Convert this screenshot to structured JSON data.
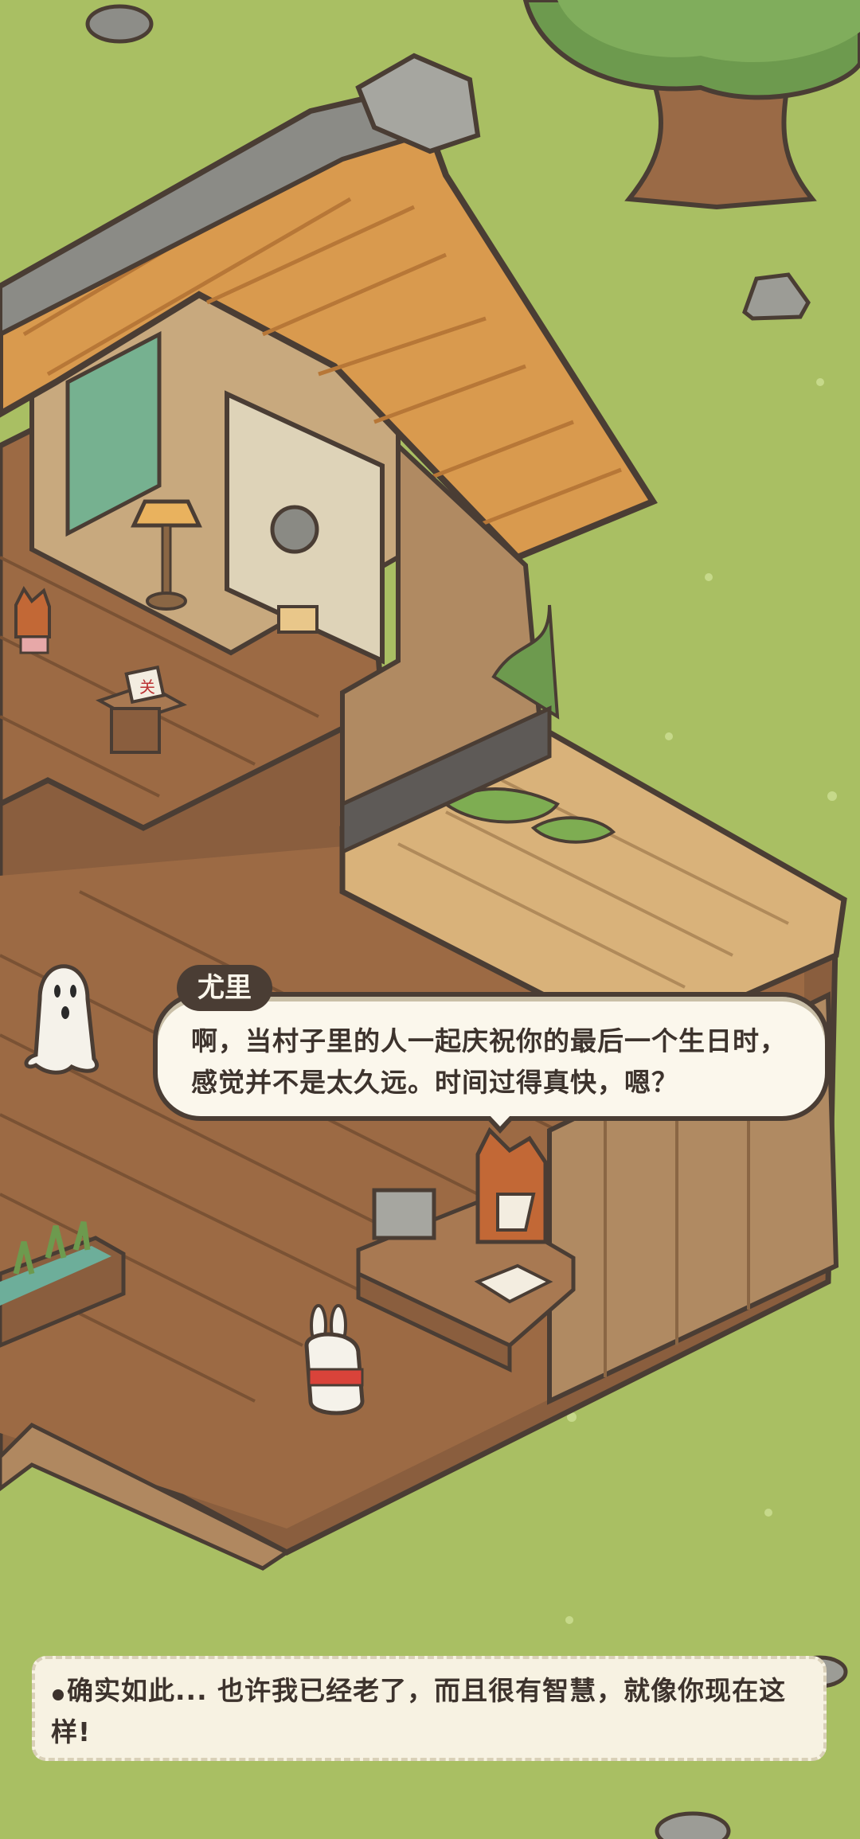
{
  "dialogue": {
    "speaker": "尤里",
    "text": "啊，当村子里的人一起庆祝你的最后一个生日时，感觉并不是太久远。时间过得真快，嗯？"
  },
  "choice": {
    "text": "确实如此... 也许我已经老了，而且很有智慧，就像你现在这样!"
  },
  "colors": {
    "grass": "#a9bf63",
    "roof": "#d99a4e",
    "wood_floor": "#9c6a44",
    "dialog_bg": "#fbf7ec",
    "dialog_border": "#4a3d34"
  },
  "sign_text": "关"
}
